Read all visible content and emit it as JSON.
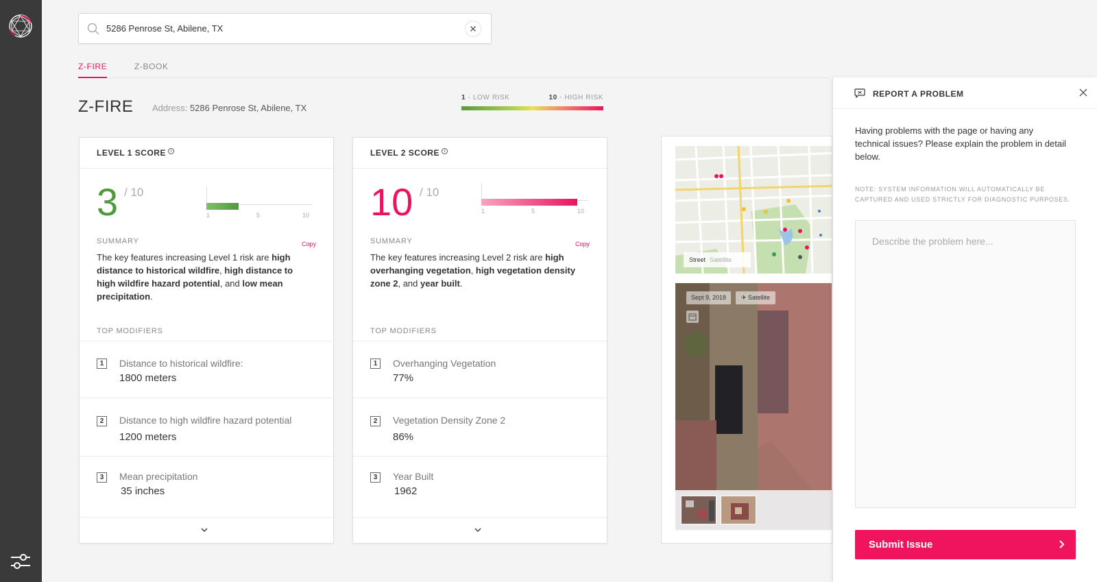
{
  "search": {
    "value": "5286 Penrose St, Abilene, TX",
    "placeholder": ""
  },
  "tabs": [
    {
      "label": "Z-FIRE",
      "active": true
    },
    {
      "label": "Z-BOOK",
      "active": false
    }
  ],
  "page": {
    "title": "Z-FIRE",
    "address_label": "Address:",
    "address_value": "5286 Penrose St, Abilene, TX"
  },
  "legend": {
    "low_num": "1",
    "low_text": " - LOW RISK",
    "high_num": "10",
    "high_text": " - HIGH RISK"
  },
  "level1": {
    "title": "LEVEL 1 SCORE",
    "score": "3",
    "denominator": "/ 10",
    "score_fraction": 0.3,
    "ticks": [
      "1",
      "5",
      "10"
    ],
    "summary_label": "SUMMARY",
    "copy_label": "Copy",
    "summary": {
      "pre": "The key features increasing Level 1 risk are ",
      "b1": "high distance to historical wildfire",
      "s1": ", ",
      "b2": "high distance to high wildfire hazard potential",
      "s2": ", and ",
      "b3": "low mean precipitation",
      "end": "."
    },
    "modifiers_label": "TOP MODIFIERS",
    "modifiers": [
      {
        "rank": "1",
        "name": "Distance to historical wildfire:",
        "value": "1800 meters"
      },
      {
        "rank": "2",
        "name": "Distance to high wildfire hazard potential",
        "value": "1200 meters"
      },
      {
        "rank": "3",
        "name": "Mean precipitation",
        "value": "35 inches"
      }
    ]
  },
  "level2": {
    "title": "LEVEL 2 SCORE",
    "score": "10",
    "denominator": "/ 10",
    "score_fraction": 0.9,
    "ticks": [
      "1",
      "5",
      "10"
    ],
    "summary_label": "SUMMARY",
    "copy_label": "Copy",
    "summary": {
      "pre": "The key features increasing Level 2 risk are ",
      "b1": "high overhanging vegetation",
      "s1": ", ",
      "b2": "high vegetation density zone 2",
      "s2": ", and ",
      "b3": "year built",
      "end": "."
    },
    "modifiers_label": "TOP MODIFIERS",
    "modifiers": [
      {
        "rank": "1",
        "name": "Overhanging Vegetation",
        "value": "77%"
      },
      {
        "rank": "2",
        "name": "Vegetation Density Zone 2",
        "value": "86%"
      },
      {
        "rank": "3",
        "name": "Year Built",
        "value": "1962"
      }
    ]
  },
  "imagery": {
    "map_street": "Street",
    "map_satellite": "Satellite",
    "date": "Sept 9, 2018",
    "sat_label": "Satellite"
  },
  "report": {
    "title": "REPORT A PROBLEM",
    "description": "Having problems with the page or having any technical issues? Please explain the problem in detail below.",
    "note": "NOTE: SYSTEM INFORMATION WILL AUTOMATICALLY BE CAPTURED AND USED STRICTLY FOR DIAGNOSTIC PURPOSES.",
    "placeholder": "Describe the problem here...",
    "submit_label": "Submit Issue"
  },
  "colors": {
    "accent": "#e8145f",
    "level1": "#4e9a3c",
    "level2": "#e8145f",
    "rail": "#3a3a3a"
  }
}
